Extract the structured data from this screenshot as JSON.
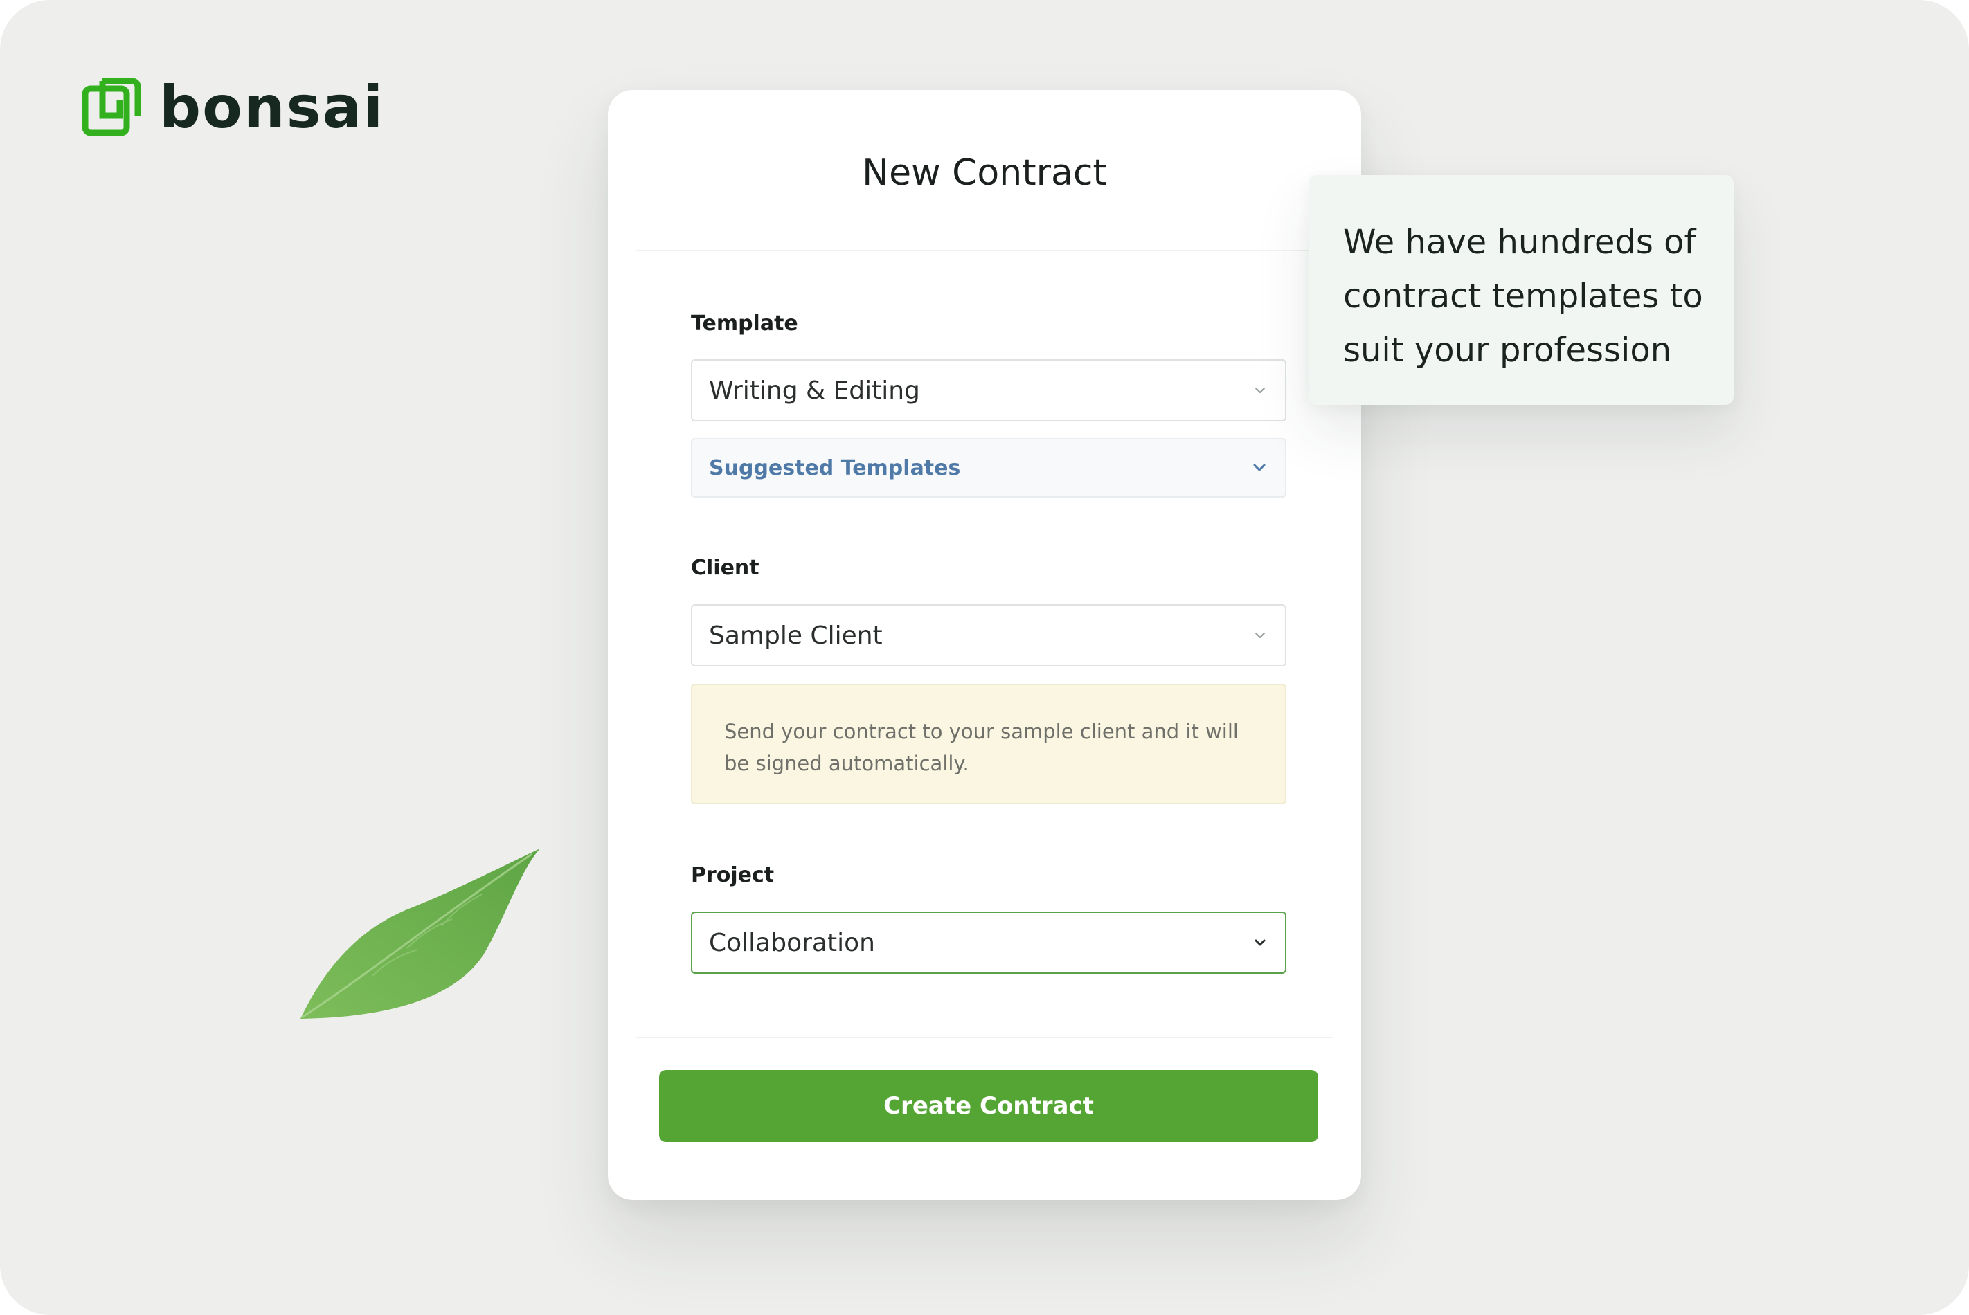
{
  "brand": {
    "name": "bonsai",
    "accent_color": "#55a534",
    "logo_icon": "bonsai-logo-icon"
  },
  "decoration": {
    "leaf_icon": "leaf-icon"
  },
  "form": {
    "title": "New Contract",
    "template": {
      "label": "Template",
      "value": "Writing & Editing",
      "suggested_label": "Suggested Templates"
    },
    "client": {
      "label": "Client",
      "value": "Sample Client",
      "note": "Send your contract to your sample client and it will be signed automatically."
    },
    "project": {
      "label": "Project",
      "value": "Collaboration"
    },
    "submit_label": "Create Contract"
  },
  "callout": {
    "text": "We have hundreds of contract templates to suit your profession"
  }
}
